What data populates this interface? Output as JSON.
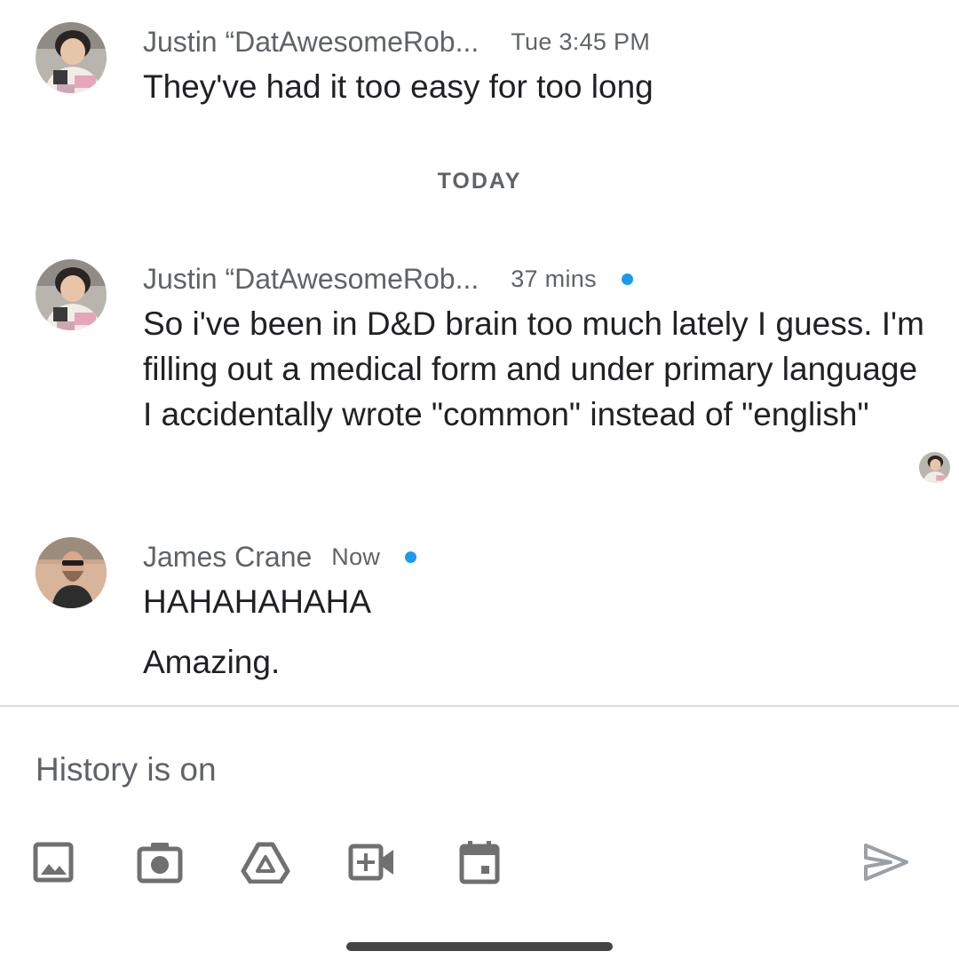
{
  "messages": [
    {
      "sender": "Justin “DatAwesomeRob...",
      "time": "Tue 3:45 PM",
      "text": "They've had it too easy for too long"
    },
    {
      "sender": "Justin “DatAwesomeRob...",
      "time": "37 mins",
      "text": "So i've been in D&D brain too much lately I guess. I'm filling out a medical form and under primary language I accidentally wrote \"common\" instead of \"english\""
    },
    {
      "sender": "James Crane",
      "time": "Now",
      "text": "HAHAHAHAHA",
      "text2": "Amazing."
    }
  ],
  "date_divider": "TODAY",
  "composer": {
    "placeholder": "History is on",
    "tools": [
      "image-icon",
      "camera-icon",
      "drive-icon",
      "video-call-icon",
      "calendar-icon"
    ],
    "send_icon": "send-icon"
  },
  "colors": {
    "unread_dot": "#1a9af0",
    "secondary_text": "#5f6368",
    "primary_text": "#202124",
    "divider": "#dadce0"
  }
}
